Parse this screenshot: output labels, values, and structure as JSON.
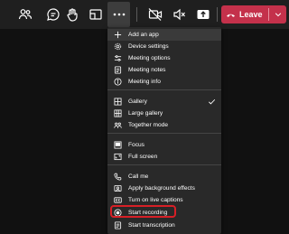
{
  "toolbar": {
    "leave_label": "Leave",
    "colors": {
      "leave_bg": "#c4314b",
      "active_bg": "#3d3d3d"
    },
    "icons": [
      "people-icon",
      "chat-icon",
      "raise-hand-icon",
      "share-screen-icon",
      "more-options-icon",
      "camera-off-icon",
      "mic-off-icon",
      "share-tray-icon"
    ]
  },
  "menu": {
    "items": [
      {
        "label": "Add an app",
        "icon": "plus-icon"
      },
      {
        "label": "Device settings",
        "icon": "gear-icon"
      },
      {
        "label": "Meeting options",
        "icon": "sliders-icon"
      },
      {
        "label": "Meeting notes",
        "icon": "notes-icon"
      },
      {
        "label": "Meeting info",
        "icon": "info-icon"
      },
      {
        "label": "Gallery",
        "icon": "grid-icon",
        "checked": true
      },
      {
        "label": "Large gallery",
        "icon": "large-grid-icon"
      },
      {
        "label": "Together mode",
        "icon": "together-icon"
      },
      {
        "label": "Focus",
        "icon": "focus-icon"
      },
      {
        "label": "Full screen",
        "icon": "fullscreen-icon"
      },
      {
        "label": "Call me",
        "icon": "phone-icon"
      },
      {
        "label": "Apply background effects",
        "icon": "background-icon"
      },
      {
        "label": "Turn on live captions",
        "icon": "captions-icon"
      },
      {
        "label": "Start recording",
        "icon": "record-icon",
        "highlighted": true
      },
      {
        "label": "Start transcription",
        "icon": "transcription-icon"
      }
    ],
    "highlight_color": "#d71f26"
  }
}
